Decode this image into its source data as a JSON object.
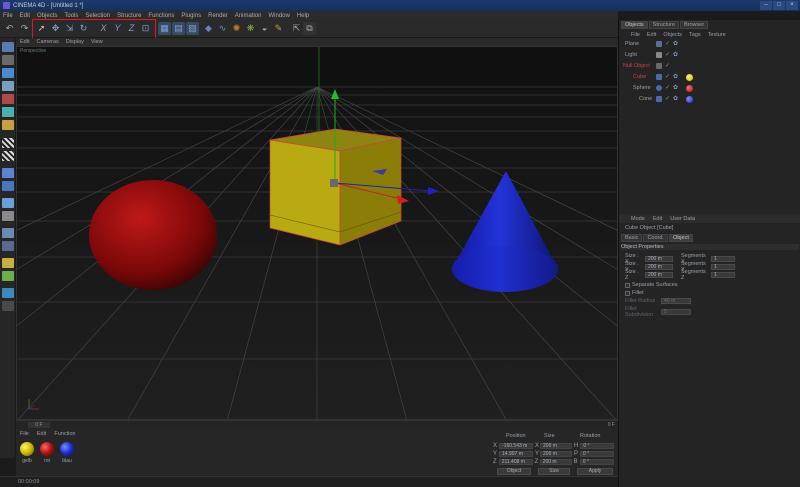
{
  "window": {
    "title": "CINEMA 4D - [Untitled 1 *]"
  },
  "menubar": [
    "File",
    "Edit",
    "Objects",
    "Tools",
    "Selection",
    "Structure",
    "Functions",
    "Plugins",
    "Render",
    "Animation",
    "Window",
    "Help"
  ],
  "viewport": {
    "menu": [
      "Edit",
      "Cameras",
      "Display",
      "View"
    ],
    "label": "Perspective"
  },
  "timeline": {
    "current_frame": "0 F",
    "end_frame": "0 F"
  },
  "materials": {
    "menu": [
      "File",
      "Edit",
      "Function"
    ],
    "items": [
      {
        "name": "gelb",
        "color": "#c9b800"
      },
      {
        "name": "rot",
        "color": "#b01010"
      },
      {
        "name": "blau",
        "color": "#1a2bd0"
      }
    ]
  },
  "coordinates": {
    "headers": [
      "Position",
      "Size",
      "Rotation"
    ],
    "rows": [
      {
        "axis": "X",
        "pos": "-160.543 m",
        "size": "200 m",
        "rot_axis": "H",
        "rot": "0 °"
      },
      {
        "axis": "Y",
        "pos": "14.997 m",
        "size": "200 m",
        "rot_axis": "P",
        "rot": "0 °"
      },
      {
        "axis": "Z",
        "pos": "211.408 m",
        "size": "200 m",
        "rot_axis": "B",
        "rot": "0 °"
      }
    ],
    "mode_object": "Object",
    "mode_size": "Size",
    "apply": "Apply"
  },
  "status": {
    "text": "00:00:09"
  },
  "object_manager": {
    "tabs": [
      "Objects",
      "Structure",
      "Browser"
    ],
    "menu": [
      "File",
      "Edit",
      "Objects",
      "Tags",
      "Texture"
    ],
    "objects": [
      {
        "name": "Plane",
        "indent": 0,
        "tag_color": ""
      },
      {
        "name": "Light",
        "indent": 0,
        "tag_color": ""
      },
      {
        "name": "Null Object",
        "indent": 0,
        "tag_color": "",
        "highlight": "#d04040"
      },
      {
        "name": "Cube",
        "indent": 1,
        "tag_color": "#c9b800",
        "highlight": "#d04040"
      },
      {
        "name": "Sphere",
        "indent": 1,
        "tag_color": "#b01010"
      },
      {
        "name": "Cone",
        "indent": 1,
        "tag_color": "#1a2bd0"
      }
    ]
  },
  "attributes": {
    "menu": [
      "Mode",
      "Edit",
      "User Data"
    ],
    "object_title": "Cube Object [Cube]",
    "tabs": [
      "Basic",
      "Coord.",
      "Object"
    ],
    "section": "Object Properties",
    "size_rows": [
      {
        "label": "Size . X",
        "value": "200 m",
        "seg_label": "Segments X",
        "seg": "1"
      },
      {
        "label": "Size . Y",
        "value": "200 m",
        "seg_label": "Segments Y",
        "seg": "1"
      },
      {
        "label": "Size . Z",
        "value": "200 m",
        "seg_label": "Segments Z",
        "seg": "1"
      }
    ],
    "separate_surfaces": "Separate Surfaces",
    "fillet": "Fillet",
    "fillet_radius_label": "Fillet Radius",
    "fillet_radius": "40 m",
    "fillet_subdivision_label": "Fillet Subdivision",
    "fillet_subdivision": "5"
  }
}
